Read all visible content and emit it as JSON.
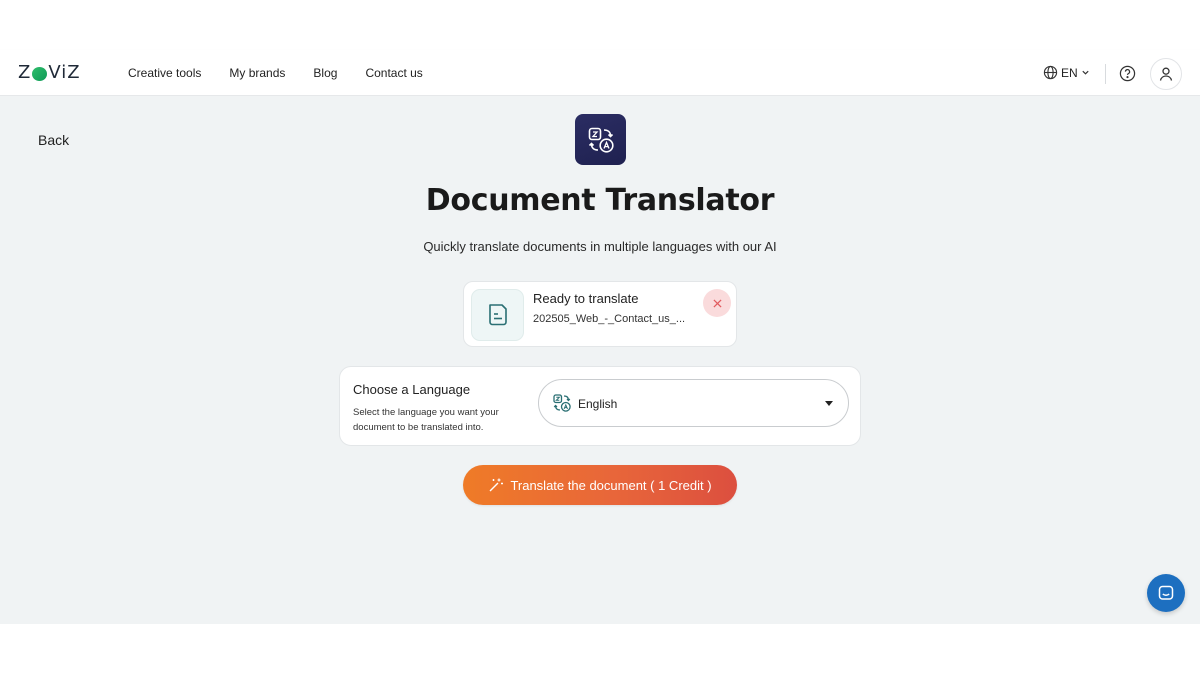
{
  "brand": {
    "logo_left": "Z",
    "logo_right": "ViZ",
    "logo_accent": "#1fae5f"
  },
  "nav": {
    "items": [
      "Creative tools",
      "My brands",
      "Blog",
      "Contact us"
    ]
  },
  "header": {
    "language": "EN",
    "icons": [
      "globe-icon",
      "chevron-down-icon",
      "help-icon",
      "user-icon"
    ]
  },
  "page": {
    "back_label": "Back",
    "title": "Document Translator",
    "subtitle": "Quickly translate documents in multiple languages with our AI",
    "icon": "translate-icon",
    "icon_bg": "#2a2c62"
  },
  "file": {
    "status": "Ready to translate",
    "name": "202505_Web_-_Contact_us_...",
    "remove_icon": "close-icon"
  },
  "language": {
    "title": "Choose a Language",
    "help": "Select the language you want your document to be translated into.",
    "selected": "English"
  },
  "action": {
    "label": "Translate the document ( 1 Credit )",
    "icon": "magic-wand-icon",
    "gradient": [
      "#ef7b27",
      "#dc4f3f"
    ]
  },
  "chat": {
    "icon": "chat-icon",
    "color": "#1d6fc0"
  }
}
